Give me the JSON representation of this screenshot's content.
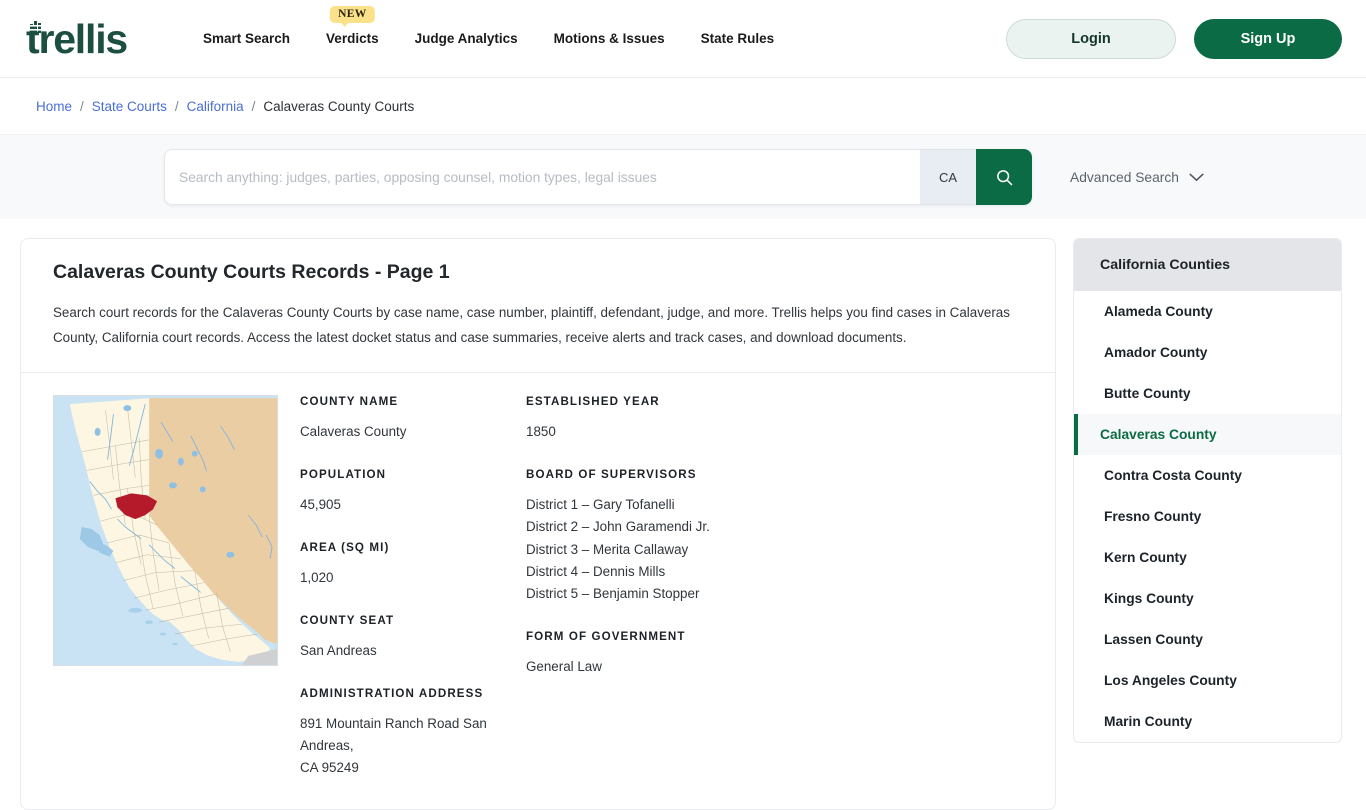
{
  "brand": {
    "name": "trellis",
    "color": "#1d4e42"
  },
  "header": {
    "nav": [
      {
        "label": "Smart Search",
        "badge": null
      },
      {
        "label": "Verdicts",
        "badge": "NEW"
      },
      {
        "label": "Judge Analytics",
        "badge": null
      },
      {
        "label": "Motions & Issues",
        "badge": null
      },
      {
        "label": "State Rules",
        "badge": null
      }
    ],
    "login_label": "Login",
    "signup_label": "Sign Up"
  },
  "breadcrumb": {
    "items": [
      {
        "label": "Home",
        "link": true
      },
      {
        "label": "State Courts",
        "link": true
      },
      {
        "label": "California",
        "link": true
      },
      {
        "label": "Calaveras County Courts",
        "link": false
      }
    ],
    "separator": "/"
  },
  "search": {
    "placeholder": "Search anything: judges, parties, opposing counsel, motion types, legal issues",
    "value": "",
    "state": "CA",
    "advanced_label": "Advanced Search",
    "search_icon": "search-icon",
    "chevron_icon": "chevron-down-icon",
    "button_color": "#0b6b45"
  },
  "main": {
    "title": "Calaveras County Courts Records - Page 1",
    "description": "Search court records for the Calaveras County Courts by case name, case number, plaintiff, defendant, judge, and more. Trellis helps you find cases in Calaveras County, California court records. Access the latest docket status and case summaries, receive alerts and track cases, and download documents.",
    "map_alt": "california-locator-map-calaveras-county",
    "fields": {
      "county_name_label": "COUNTY NAME",
      "county_name_value": "Calaveras County",
      "population_label": "POPULATION",
      "population_value": "45,905",
      "area_label": "AREA (SQ MI)",
      "area_value": "1,020",
      "county_seat_label": "COUNTY SEAT",
      "county_seat_value": "San Andreas",
      "administration_address_label": "ADMINISTRATION ADDRESS",
      "administration_address_line1": "891 Mountain Ranch Road San Andreas,",
      "administration_address_line2": "CA 95249",
      "established_year_label": "ESTABLISHED YEAR",
      "established_year_value": "1850",
      "board_label": "BOARD OF SUPERVISORS",
      "board_members": [
        "District 1 – Gary Tofanelli",
        "District 2 – John Garamendi Jr.",
        "District 3 – Merita Callaway",
        "District 4 – Dennis Mills",
        "District 5 – Benjamin Stopper"
      ],
      "government_label": "FORM OF GOVERNMENT",
      "government_value": "General Law"
    }
  },
  "sidebar": {
    "title": "California Counties",
    "active": "Calaveras County",
    "accent": "#0b6b45",
    "items": [
      {
        "label": "Alameda County",
        "active": false
      },
      {
        "label": "Amador County",
        "active": false
      },
      {
        "label": "Butte County",
        "active": false
      },
      {
        "label": "Calaveras County",
        "active": true
      },
      {
        "label": "Contra Costa County",
        "active": false
      },
      {
        "label": "Fresno County",
        "active": false
      },
      {
        "label": "Kern County",
        "active": false
      },
      {
        "label": "Kings County",
        "active": false
      },
      {
        "label": "Lassen County",
        "active": false
      },
      {
        "label": "Los Angeles County",
        "active": false
      },
      {
        "label": "Marin County",
        "active": false
      }
    ]
  }
}
